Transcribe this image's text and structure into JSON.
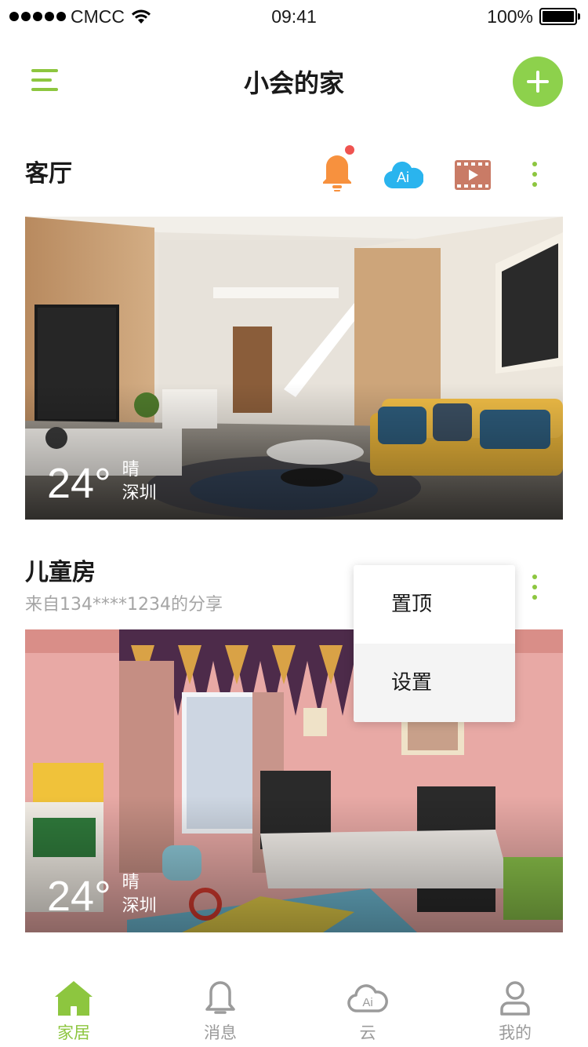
{
  "status_bar": {
    "carrier": "CMCC",
    "time": "09:41",
    "battery": "100%",
    "battery_level": 1.0
  },
  "header": {
    "title": "小会的家",
    "menu_icon": "hamburger-menu-icon",
    "add_icon": "plus-icon"
  },
  "colors": {
    "accent": "#8dc63f",
    "add_button": "#8dd14c",
    "bell": "#f7913e",
    "cloud": "#2ab4ee",
    "video": "#c97b66",
    "notification_dot": "#ef5350"
  },
  "rooms": [
    {
      "title": "客厅",
      "subtitle": "",
      "temperature": "24°",
      "weather": "晴",
      "city": "深圳",
      "tools": [
        "bell-icon",
        "ai-cloud-icon",
        "video-icon",
        "more-icon"
      ],
      "ai_label": "Ai"
    },
    {
      "title": "儿童房",
      "subtitle": "来自134****1234的分享",
      "temperature": "24°",
      "weather": "晴",
      "city": "深圳"
    }
  ],
  "popup_menu": {
    "items": [
      "置顶",
      "设置"
    ]
  },
  "tabbar": {
    "items": [
      {
        "label": "家居",
        "icon": "home-icon",
        "active": true
      },
      {
        "label": "消息",
        "icon": "bell-icon",
        "active": false
      },
      {
        "label": "云",
        "icon": "cloud-icon",
        "active": false,
        "badge": "Ai"
      },
      {
        "label": "我的",
        "icon": "user-icon",
        "active": false
      }
    ]
  }
}
